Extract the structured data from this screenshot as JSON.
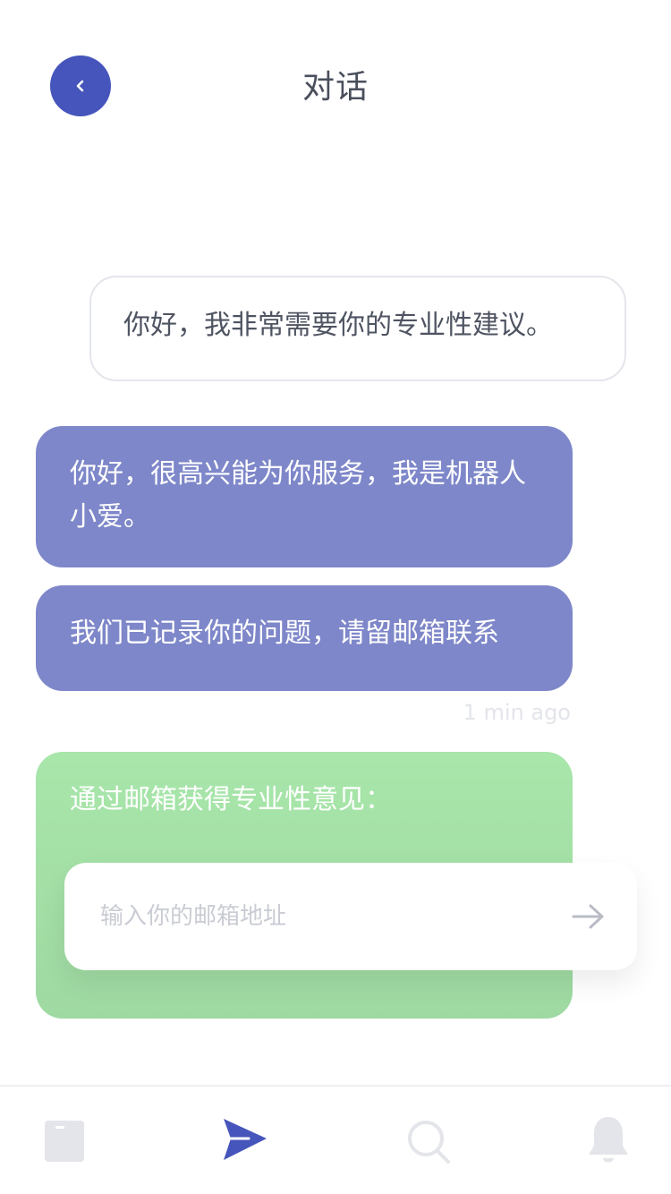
{
  "header": {
    "title": "对话",
    "back_icon": "chevron-left-icon"
  },
  "messages": [
    {
      "sender": "user",
      "text": "你好，我非常需要你的专业性建议。"
    },
    {
      "sender": "bot",
      "text": "你好，很高兴能为你服务，我是机器人小爱。"
    },
    {
      "sender": "bot",
      "text": "我们已记录你的问题，请留邮箱联系"
    }
  ],
  "timestamp": "1 min ago",
  "email_card": {
    "prompt": "通过邮箱获得专业性意见：",
    "placeholder": "输入你的邮箱地址",
    "value": "",
    "submit_icon": "arrow-right-icon"
  },
  "bottom_nav": {
    "items": [
      {
        "icon": "document-icon",
        "active": false
      },
      {
        "icon": "send-icon",
        "active": true
      },
      {
        "icon": "search-icon",
        "active": false
      },
      {
        "icon": "bell-icon",
        "active": false
      }
    ]
  },
  "colors": {
    "accent": "#4655bb",
    "bot_bubble": "#7e87c9",
    "green_bubble": "#a8e6aa",
    "user_border": "#e4e6ec",
    "inactive_icon": "#e3e5ea"
  }
}
